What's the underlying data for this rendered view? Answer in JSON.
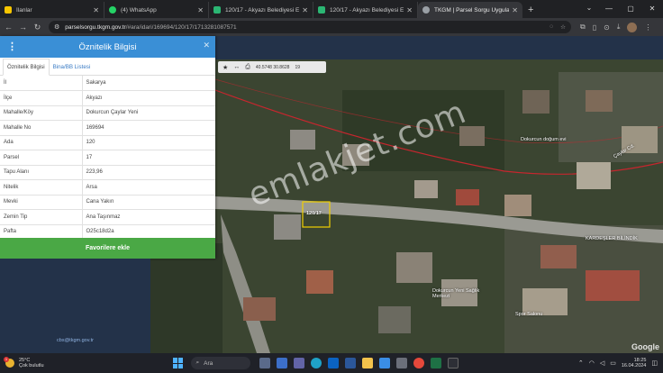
{
  "browser": {
    "tabs": [
      {
        "title": "İlanlar",
        "favicon_color": "#f7c600"
      },
      {
        "title": "(4) WhatsApp",
        "favicon_color": "#25d366"
      },
      {
        "title": "120/17 - Akyazı Belediyesi E-İm",
        "favicon_color": "#2bb673"
      },
      {
        "title": "120/17 - Akyazı Belediyesi E-İm",
        "favicon_color": "#2bb673"
      },
      {
        "title": "TKGM | Parsel Sorgu Uygulama",
        "favicon_color": "#9aa0a6"
      }
    ],
    "url_host": "parselsorgu.tkgm.gov.tr",
    "url_path": "/#ara/idari/169694/120/17/1713281087571"
  },
  "panel": {
    "title": "Öznitelik Bilgisi",
    "tabs": [
      "Öznitelik Bilgisi",
      "Bina/BB Listesi"
    ],
    "rows": [
      {
        "key": "İl",
        "value": "Sakarya"
      },
      {
        "key": "İlçe",
        "value": "Akyazı"
      },
      {
        "key": "Mahalle/Köy",
        "value": "Dokurcun Çaylar Yeni"
      },
      {
        "key": "Mahalle No",
        "value": "169694"
      },
      {
        "key": "Ada",
        "value": "120"
      },
      {
        "key": "Parsel",
        "value": "17"
      },
      {
        "key": "Tapu Alanı",
        "value": "223,96"
      },
      {
        "key": "Nitelik",
        "value": "Arsa"
      },
      {
        "key": "Mevki",
        "value": "Cana Yakın"
      },
      {
        "key": "Zemin Tip",
        "value": "Ana Taşınmaz"
      },
      {
        "key": "Pafta",
        "value": "O25c18d2a"
      }
    ],
    "favorite_button": "Favorilere ekle"
  },
  "map": {
    "toolbar_coords": "40.5748  30.8628",
    "toolbar_zoom": "19",
    "parcel_label": "120/17",
    "watermark": "emlakjet.com",
    "places": [
      "Dokurcun doğum evi",
      "Dokurcun Yeni Sağlık Merkezi",
      "Spor Salonu",
      "KARDEŞLER BİLİNDİK",
      "Çaylar Cd."
    ],
    "attribution": "Google"
  },
  "footer_email": "cbs@tkgm.gov.tr",
  "taskbar": {
    "weather_temp": "25°C",
    "weather_desc": "Çok bulutlu",
    "weather_badge": "1",
    "search": "Ara",
    "time": "18:25",
    "date": "16.04.2024"
  }
}
